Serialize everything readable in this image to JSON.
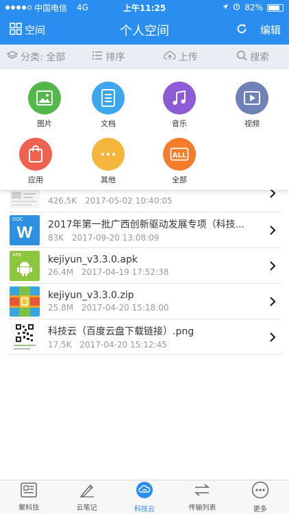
{
  "status_bar": {
    "carrier": "中国电信",
    "network": "4G",
    "time": "上午11:25",
    "battery": "82%",
    "battery_level": 0.82
  },
  "nav": {
    "left_label": "空间",
    "title": "个人空间",
    "edit_label": "编辑"
  },
  "toolbar": {
    "category": "分类: 全部",
    "sort": "排序",
    "upload": "上传",
    "search": "搜索"
  },
  "categories": [
    {
      "label": "图片",
      "icon": "image-icon",
      "color": "#52b84a"
    },
    {
      "label": "文档",
      "icon": "document-icon",
      "color": "#3ea6ea"
    },
    {
      "label": "音乐",
      "icon": "music-icon",
      "color": "#8e5bd6"
    },
    {
      "label": "视频",
      "icon": "video-icon",
      "color": "#6f82b8"
    },
    {
      "label": "应用",
      "icon": "app-bag-icon",
      "color": "#ef6250"
    },
    {
      "label": "其他",
      "icon": "more-icon",
      "color": "#f4b63c"
    },
    {
      "label": "全部",
      "icon": "all-icon",
      "color": "#f47c2a"
    }
  ],
  "files": [
    {
      "name": "",
      "size": "426.5K",
      "date": "2017-05-02 10:40:05",
      "thumb": "image-thumb"
    },
    {
      "name": "2017年第一批广西创新驱动发展专项（科技...",
      "size": "83K",
      "date": "2017-09-20 13:08:09",
      "thumb": "doc-thumb",
      "badge": "DOC",
      "letter": "W"
    },
    {
      "name": "kejiyun_v3.3.0.apk",
      "size": "26.4M",
      "date": "2017-04-19 17:52:38",
      "thumb": "apk-thumb",
      "badge": "APK"
    },
    {
      "name": "kejiyun_v3.3.0.zip",
      "size": "25.8M",
      "date": "2017-04-20 15:18:00",
      "thumb": "zip-thumb"
    },
    {
      "name": "科技云（百度云盘下载链接）.png",
      "size": "17.5K",
      "date": "2017-04-20 15:12:45",
      "thumb": "qr-thumb"
    }
  ],
  "tabs": [
    {
      "label": "聚科技",
      "icon": "news-icon",
      "active": false
    },
    {
      "label": "云笔记",
      "icon": "pen-icon",
      "active": false
    },
    {
      "label": "科技云",
      "icon": "cloud-icon",
      "active": true
    },
    {
      "label": "传输列表",
      "icon": "transfer-icon",
      "active": false
    },
    {
      "label": "更多",
      "icon": "more-dots-icon",
      "active": false
    }
  ],
  "colors": {
    "primary": "#2a8ef0",
    "toolbar_bg": "#e9eef4"
  }
}
